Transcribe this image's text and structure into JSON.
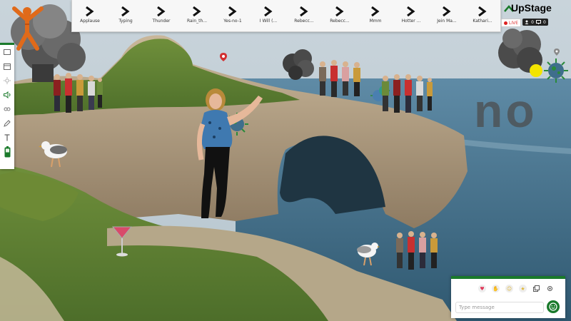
{
  "app": {
    "name": "UpStage"
  },
  "status": {
    "live_label": "LIVE",
    "viewers": "0",
    "screens": "0"
  },
  "audio_bar": {
    "items": [
      {
        "label": "Applause"
      },
      {
        "label": "Typing"
      },
      {
        "label": "Thunder"
      },
      {
        "label": "Rain_th..."
      },
      {
        "label": "Yes-no-1"
      },
      {
        "label": "I Will (..."
      },
      {
        "label": "Rebecc..."
      },
      {
        "label": "Rebecc..."
      },
      {
        "label": "Mmm"
      },
      {
        "label": "Hotter ..."
      },
      {
        "label": "Jein Ma..."
      },
      {
        "label": "Kathari..."
      }
    ]
  },
  "stage": {
    "overlay_text": "no"
  },
  "chat": {
    "placeholder": "Type message"
  },
  "colors": {
    "brand_green": "#1a7a2b",
    "live_red": "#d22222",
    "audio_bar_bg": "#f7f7f7"
  },
  "toolbar": {
    "icons": [
      "rectangle-icon",
      "backdrop-icon",
      "sun-icon",
      "speaker-icon",
      "stream-icon",
      "pen-icon",
      "text-icon",
      "battery-icon"
    ]
  }
}
